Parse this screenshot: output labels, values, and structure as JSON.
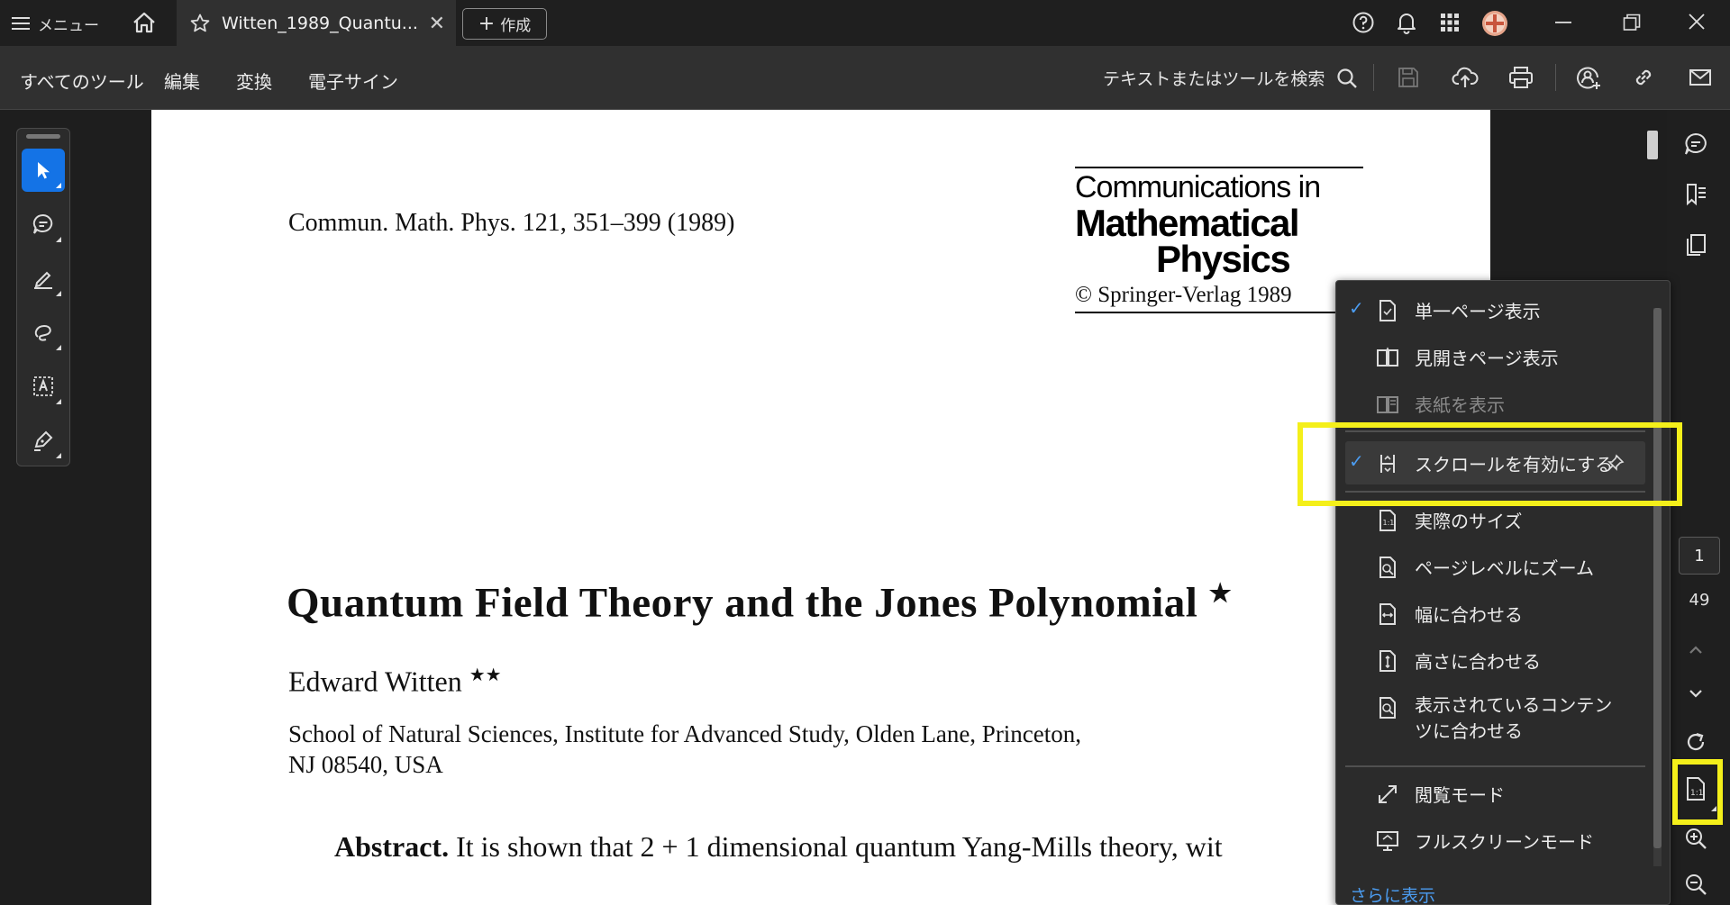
{
  "titlebar": {
    "menu_label": "メニュー",
    "tab_title": "Witten_1989_Quantu...",
    "create_label": "作成"
  },
  "toolbar": {
    "tabs": [
      "すべてのツール",
      "編集",
      "変換",
      "電子サイン"
    ],
    "search_label": "テキストまたはツールを検索"
  },
  "document": {
    "journal_ref": "Commun. Math. Phys. 121, 351–399 (1989)",
    "logo_line1": "Communications in",
    "logo_line2": "Mathematical",
    "logo_line3": "Physics",
    "logo_copyright": "© Springer-Verlag 1989",
    "title": "Quantum Field Theory and the Jones Polynomial",
    "title_mark": "★",
    "author": "Edward Witten",
    "author_mark": "★★",
    "affiliation_line1": "School of Natural Sciences, Institute for Advanced Study, Olden Lane, Princeton,",
    "affiliation_line2": "NJ 08540, USA",
    "abstract_label": "Abstract.",
    "abstract_text": "It is shown that 2 + 1 dimensional quantum Yang-Mills theory, wit"
  },
  "view_menu": {
    "items": [
      {
        "label": "単一ページ表示",
        "checked": true,
        "icon": "single-page-icon"
      },
      {
        "label": "見開きページ表示",
        "checked": false,
        "icon": "two-page-icon"
      },
      {
        "label": "表紙を表示",
        "checked": false,
        "disabled": true,
        "icon": "cover-page-icon"
      },
      {
        "label": "スクロールを有効にする",
        "checked": true,
        "icon": "scroll-icon"
      },
      {
        "label": "実際のサイズ",
        "checked": false,
        "icon": "actual-size-icon"
      },
      {
        "label": "ページレベルにズーム",
        "checked": false,
        "icon": "zoom-page-icon"
      },
      {
        "label": "幅に合わせる",
        "checked": false,
        "icon": "fit-width-icon"
      },
      {
        "label": "高さに合わせる",
        "checked": false,
        "icon": "fit-height-icon"
      },
      {
        "label_line1": "表示されているコンテン",
        "label_line2": "ツに合わせる",
        "checked": false,
        "icon": "fit-visible-icon"
      },
      {
        "label": "閲覧モード",
        "checked": false,
        "icon": "read-mode-icon"
      },
      {
        "label": "フルスクリーンモード",
        "checked": false,
        "icon": "fullscreen-icon"
      }
    ],
    "more_link": "さらに表示"
  },
  "page_nav": {
    "current_page": "1",
    "total_pages": "49"
  },
  "colors": {
    "accent": "#1473e6",
    "highlight_box": "#f4ef1a",
    "check": "#4b9cf0"
  }
}
